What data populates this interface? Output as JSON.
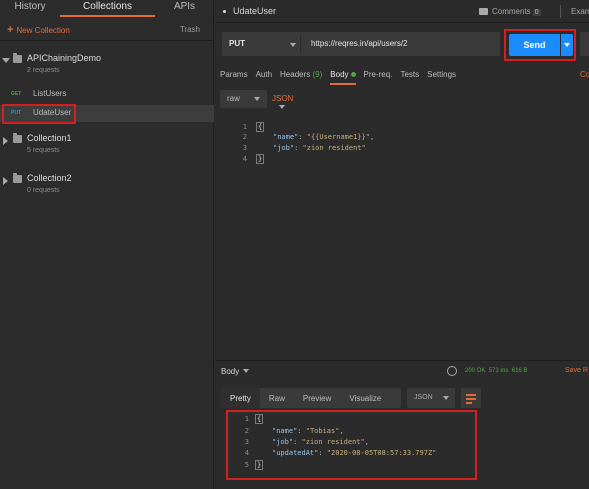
{
  "sidebar": {
    "tabs": {
      "history": "History",
      "collections": "Collections",
      "apis": "APIs"
    },
    "new_collection": "New Collection",
    "trash": "Trash",
    "collections": [
      {
        "name": "APIChainingDemo",
        "requests": "2 requests",
        "expanded": true
      },
      {
        "name": "Collection1",
        "requests": "5 requests",
        "expanded": false
      },
      {
        "name": "Collection2",
        "requests": "0 requests",
        "expanded": false
      }
    ],
    "requests": [
      {
        "method": "GET",
        "name": "ListUsers",
        "method_color": "#59a14f"
      },
      {
        "method": "PUT",
        "name": "UdateUser",
        "method_color": "#3d8fd1",
        "selected": true
      }
    ]
  },
  "tab": {
    "name": "UdateUser",
    "comments": "Comments",
    "comments_count": "0",
    "exam": "Exam"
  },
  "request": {
    "method": "PUT",
    "url": "https://reqres.in/api/users/2",
    "send": "Send"
  },
  "subtabs": {
    "params": "Params",
    "auth": "Auth",
    "headers": "Headers",
    "headers_count": "(9)",
    "body": "Body",
    "prereq": "Pre-req.",
    "tests": "Tests",
    "settings": "Settings",
    "cookies": "Co"
  },
  "body_format": {
    "mode": "raw",
    "language": "JSON"
  },
  "request_body": {
    "line_numbers": [
      "1",
      "2",
      "3",
      "4"
    ],
    "open_brace": "{",
    "close_brace": "}",
    "name_key": "\"name\"",
    "name_value": "\"{{Username1}}\"",
    "job_key": "\"job\"",
    "job_value": "\"zion resident\""
  },
  "response": {
    "label": "Body",
    "status": "200 OK",
    "time": "573 ms",
    "size": "616 B",
    "save": "Save R",
    "views": {
      "pretty": "Pretty",
      "raw": "Raw",
      "preview": "Preview",
      "visualize": "Visualize"
    },
    "format": "JSON",
    "line_numbers": [
      "1",
      "2",
      "3",
      "4",
      "5"
    ],
    "open_brace": "{",
    "close_brace": "}",
    "name_key": "\"name\"",
    "name_value": "\"Tobias\"",
    "job_key": "\"job\"",
    "job_value": "\"zion resident\"",
    "updated_key": "\"updatedAt\"",
    "updated_value": "\"2020-08-05T08:57:33.797Z\""
  },
  "colors": {
    "accent": "#e36c3a",
    "send": "#1a8cff",
    "highlight": "#d21f1f",
    "success": "#59a14f"
  }
}
